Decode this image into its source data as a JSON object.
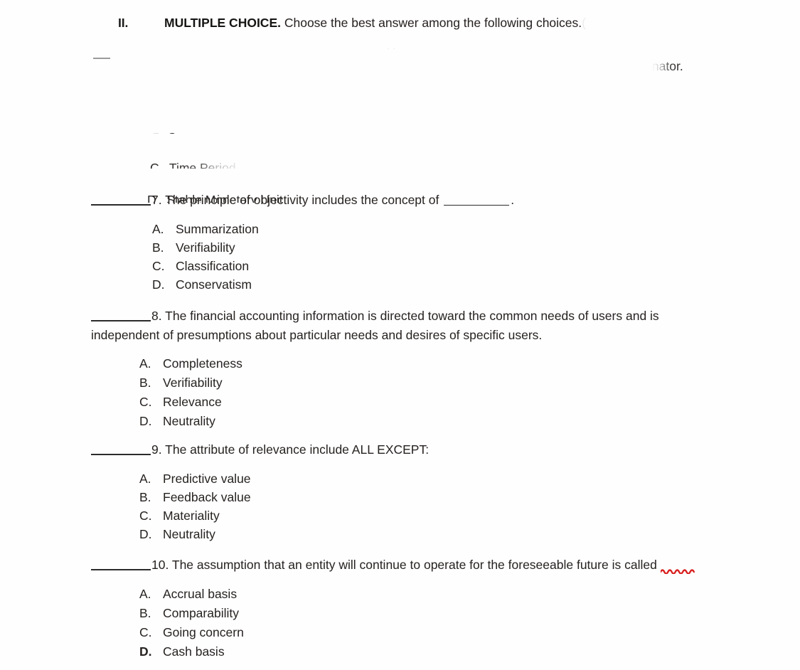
{
  "document": {
    "section_number": "II.",
    "section_title": "MULTIPLE CHOICE.",
    "section_instruction": " Choose the best answer among the following choices.",
    "section_instruction_tail": "(",
    "clipped_fragments": {
      "top_right_tail": "minator.",
      "frag_b": "B. C",
      "frag_time_period": "C.  Time Period",
      "frag_stable_monetary": "D.  Stable Monetary Unit"
    }
  },
  "questions": [
    {
      "number": "7",
      "number_label": "7. ",
      "stem_before_blank": "The principle of objectivity includes the concept of ",
      "stem_after_blank": ".",
      "has_inline_blank": true,
      "options": [
        {
          "letter": "A.",
          "text": "Summarization",
          "bold_letter": false
        },
        {
          "letter": "B.",
          "text": "Verifiability",
          "bold_letter": false
        },
        {
          "letter": "C.",
          "text": "Classification",
          "bold_letter": false
        },
        {
          "letter": "D.",
          "text": "Conservatism",
          "bold_letter": false
        }
      ]
    },
    {
      "number": "8",
      "number_label": "8. ",
      "stem_line1": "The financial accounting information is directed toward the common needs of users and is",
      "stem_line2": "independent of presumptions about particular needs and desires of specific users.",
      "has_inline_blank": false,
      "options": [
        {
          "letter": "A.",
          "text": "Completeness",
          "bold_letter": false
        },
        {
          "letter": "B.",
          "text": "Verifiability",
          "bold_letter": false
        },
        {
          "letter": "C.",
          "text": "Relevance",
          "bold_letter": false
        },
        {
          "letter": "D.",
          "text": "Neutrality",
          "bold_letter": false
        }
      ]
    },
    {
      "number": "9",
      "number_label": "9. ",
      "stem_line1": "The attribute of relevance include ALL EXCEPT:",
      "has_inline_blank": false,
      "options": [
        {
          "letter": "A.",
          "text": "Predictive value",
          "bold_letter": false
        },
        {
          "letter": "B.",
          "text": "Feedback value",
          "bold_letter": false
        },
        {
          "letter": "C.",
          "text": "Materiality",
          "bold_letter": false
        },
        {
          "letter": "D.",
          "text": "Neutrality",
          "bold_letter": false
        }
      ]
    },
    {
      "number": "10",
      "number_label": "10. ",
      "stem_line1": "The assumption that an entity will continue to operate for the foreseeable future is ",
      "stem_misspelled_word": "called",
      "has_inline_blank": false,
      "spellcheck_underline": true,
      "options": [
        {
          "letter": "A.",
          "text": "Accrual basis",
          "bold_letter": false
        },
        {
          "letter": "B.",
          "text": "Comparability",
          "bold_letter": false
        },
        {
          "letter": "C.",
          "text": "Going concern",
          "bold_letter": false
        },
        {
          "letter": "D.",
          "text": "Cash basis",
          "bold_letter": true
        }
      ]
    }
  ],
  "colors": {
    "page_background": "#fefefe",
    "text": "#262220",
    "blank_rule": "#2b2b2b",
    "spellcheck_squiggle": "#d8201f",
    "faint_dash": "#8a8a8a"
  }
}
